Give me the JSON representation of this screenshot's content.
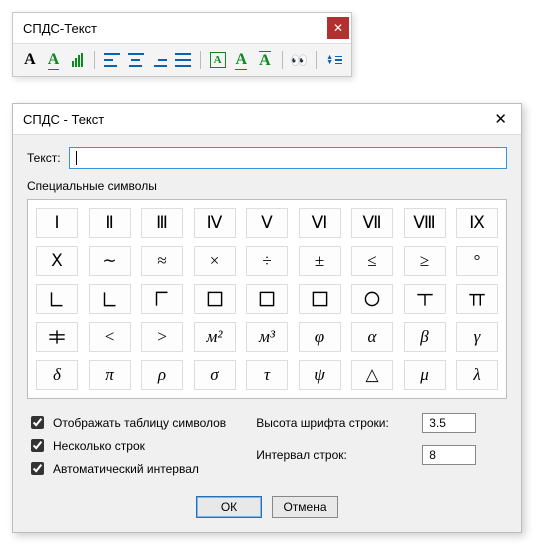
{
  "toolbar_panel": {
    "title": "СПДС-Текст",
    "close_glyph": "✕"
  },
  "dialog": {
    "title": "СПДС - Текст",
    "close_glyph": "✕",
    "text_label": "Текст:",
    "text_value": "",
    "group_label": "Специальные символы",
    "symbols": {
      "row1": [
        "Ⅰ",
        "Ⅱ",
        "Ⅲ",
        "Ⅳ",
        "Ⅴ",
        "Ⅵ",
        "Ⅶ",
        "Ⅷ",
        "Ⅸ"
      ],
      "row2": [
        "Ⅹ",
        "∼",
        "≈",
        "×",
        "÷",
        "±",
        "≤",
        "≥",
        "°"
      ],
      "row3": [
        "⌊",
        "⌊",
        "⌈",
        "□",
        "□",
        "□",
        "○",
        "⊤",
        "⊤"
      ],
      "row4": [
        "⊤",
        "<",
        ">",
        "м²",
        "м³",
        "φ",
        "α",
        "β",
        "γ"
      ],
      "row5": [
        "δ",
        "π",
        "ρ",
        "σ",
        "τ",
        "ψ",
        "△",
        "μ",
        "λ"
      ]
    },
    "checks": {
      "show_table": "Отображать таблицу символов",
      "multi_line": "Несколько строк",
      "auto_spacing": "Автоматический интервал",
      "show_table_checked": true,
      "multi_line_checked": true,
      "auto_spacing_checked": true
    },
    "height_label": "Высота шрифта строки:",
    "height_value": "3.5",
    "interval_label": "Интервал строк:",
    "interval_value": "8",
    "ok_label": "ОК",
    "cancel_label": "Отмена"
  }
}
